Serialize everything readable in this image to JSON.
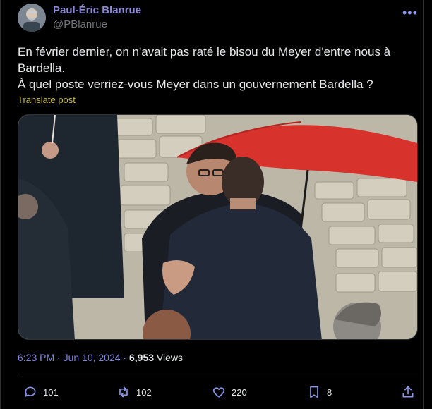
{
  "author": {
    "display_name": "Paul-Éric Blanrue",
    "handle": "@PBlanrue"
  },
  "tweet": {
    "line1": "En février dernier, on n'avait pas raté le bisou du Meyer d'entre nous à Bardella.",
    "line2": "À quel poste verriez-vous Meyer dans un gouvernement Bardella ?",
    "translate_label": "Translate post",
    "time": "6:23 PM · Jun 10, 2024 · ",
    "views_count": "6,953",
    "views_label": " Views"
  },
  "actions": {
    "replies": "101",
    "reposts": "102",
    "likes": "220",
    "bookmarks": "8"
  },
  "icons": [
    "avatar-photo",
    "more-icon",
    "reply-icon",
    "repost-icon",
    "like-icon",
    "bookmark-icon",
    "share-icon"
  ],
  "colors": {
    "accent": "#8e8ad8",
    "translate": "#c6b94f",
    "umbrella": "#d8322d"
  }
}
